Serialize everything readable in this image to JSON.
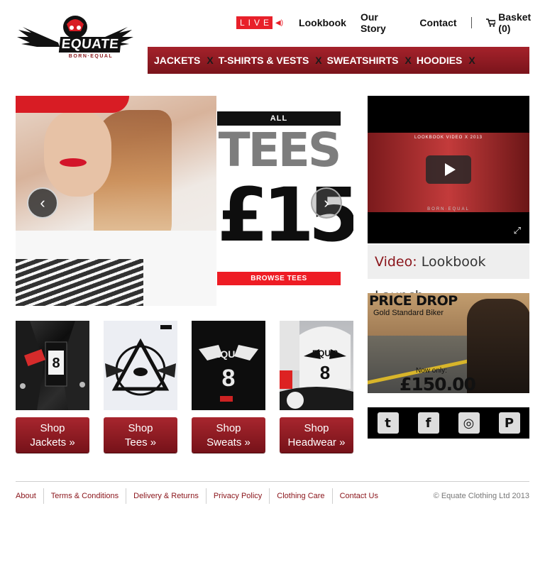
{
  "brand": {
    "name": "EQUATE",
    "tagline": "BORN·EQUAL"
  },
  "topnav": {
    "live": "LIVE",
    "links": [
      "Lookbook",
      "Our Story",
      "Contact"
    ],
    "basket": "Basket (0)"
  },
  "categories": [
    "JACKETS",
    "T-SHIRTS & VESTS",
    "SWEATSHIRTS",
    "HOODIES"
  ],
  "category_separator": "X",
  "hero": {
    "promo_all": "ALL",
    "promo_tees": "TEES",
    "promo_price": "£15",
    "promo_button": "BROWSE TEES",
    "prev": "‹",
    "next": "›"
  },
  "thumb_prints": {
    "equ8": "EQU 8",
    "eight": "8"
  },
  "shop_buttons": [
    {
      "line1": "Shop",
      "line2": "Jackets »"
    },
    {
      "line1": "Shop",
      "line2": "Tees »"
    },
    {
      "line1": "Shop",
      "line2": "Sweats »"
    },
    {
      "line1": "Shop",
      "line2": "Headwear »"
    }
  ],
  "video": {
    "frame_title": "LOOKBOOK VIDEO X 2013",
    "frame_brand": "BORN·EQUAL",
    "caption_label": "Video:",
    "caption_text": "Lookbook Launch"
  },
  "price_drop": {
    "title": "PRICE DROP",
    "subtitle": "Gold Standard Biker",
    "now_only": "Now only:",
    "price": "£150.00"
  },
  "social": {
    "twitter": "t",
    "facebook": "f",
    "instagram": "◎",
    "pinterest": "P"
  },
  "footer": {
    "links": [
      "About",
      "Terms & Conditions",
      "Delivery & Returns",
      "Privacy Policy",
      "Clothing Care",
      "Contact Us"
    ],
    "copyright": "© Equate Clothing Ltd 2013"
  },
  "colors": {
    "brand_red": "#8a141a",
    "live_red": "#e8202a",
    "promo_red": "#ee1c24"
  }
}
